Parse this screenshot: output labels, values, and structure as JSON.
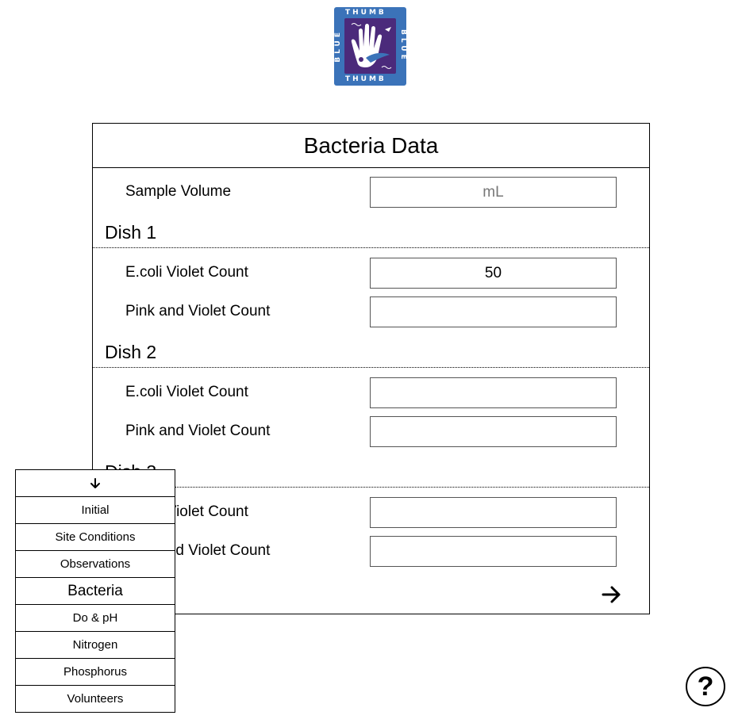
{
  "logo": {
    "top_text": "THUMB",
    "bottom_text": "THUMB",
    "left_text": "BLUE",
    "right_text": "BLUE",
    "colors": {
      "outer": "#3b73b9",
      "inner": "#4b2a7b"
    }
  },
  "form": {
    "title": "Bacteria Data",
    "sample_volume": {
      "label": "Sample Volume",
      "value": "",
      "placeholder": "mL"
    },
    "dishes": [
      {
        "heading": "Dish 1",
        "ecoli": {
          "label": "E.coli Violet Count",
          "value": "50"
        },
        "pink_violet": {
          "label": "Pink and Violet Count",
          "value": ""
        }
      },
      {
        "heading": "Dish 2",
        "ecoli": {
          "label": "E.coli Violet Count",
          "value": ""
        },
        "pink_violet": {
          "label": "Pink and Violet Count",
          "value": ""
        }
      },
      {
        "heading": "Dish 3",
        "ecoli": {
          "label": "E.coli Violet Count",
          "value": ""
        },
        "pink_violet": {
          "label": "Pink and Violet Count",
          "value": ""
        }
      }
    ],
    "next_icon": "arrow-right-icon"
  },
  "nav": {
    "toggle_icon": "arrow-down-icon",
    "items": [
      {
        "label": "Initial"
      },
      {
        "label": "Site Conditions"
      },
      {
        "label": "Observations"
      },
      {
        "label": "Bacteria",
        "active": true
      },
      {
        "label": "Do & pH"
      },
      {
        "label": "Nitrogen"
      },
      {
        "label": "Phosphorus"
      },
      {
        "label": "Volunteers"
      }
    ]
  },
  "help": {
    "label": "?"
  }
}
